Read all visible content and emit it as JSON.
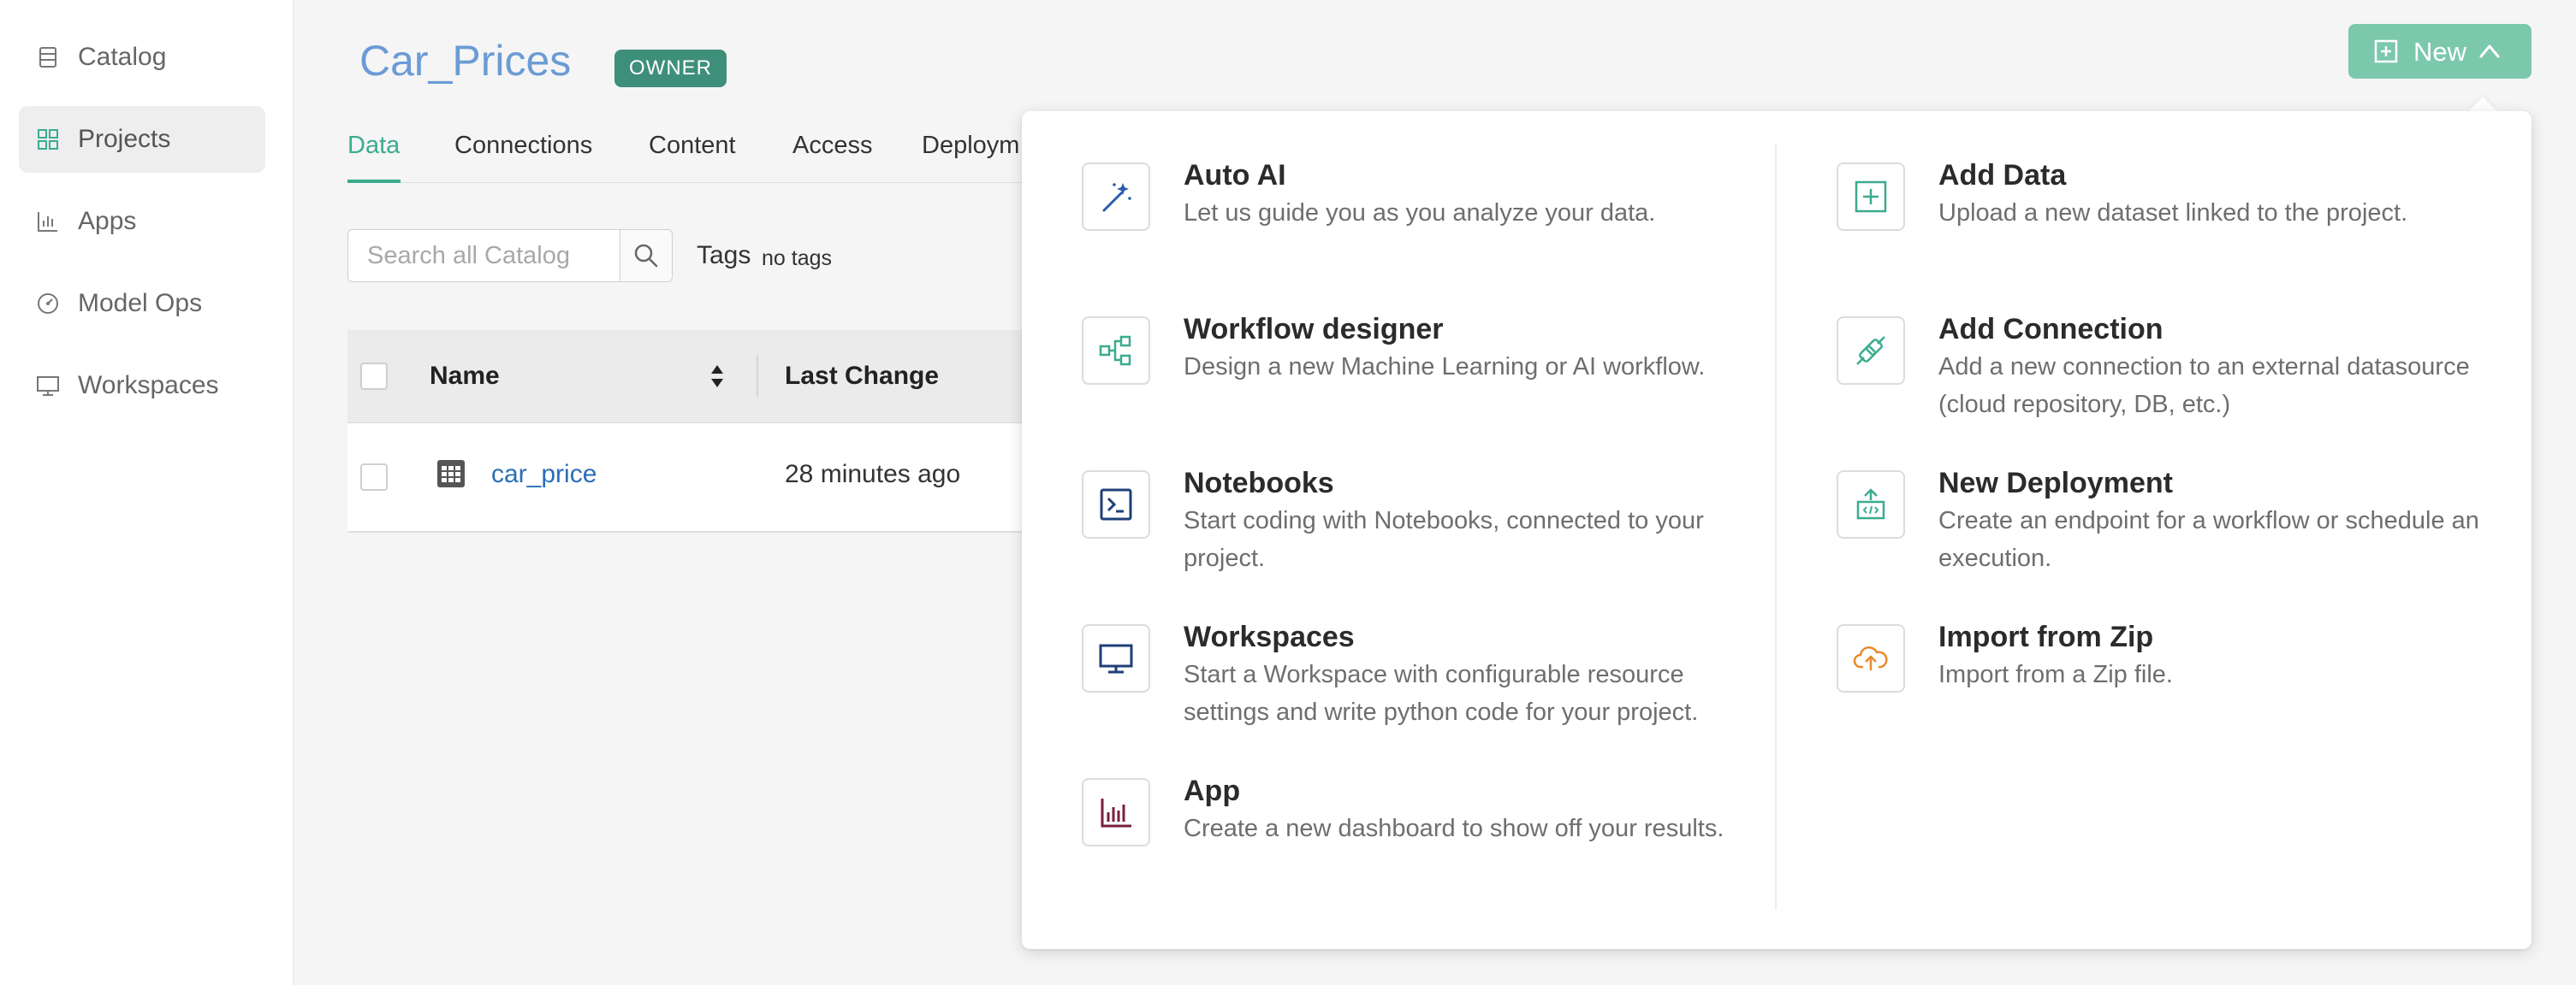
{
  "sidebar": {
    "items": [
      {
        "label": "Catalog",
        "icon": "catalog-icon",
        "active": false
      },
      {
        "label": "Projects",
        "icon": "projects-icon",
        "active": true
      },
      {
        "label": "Apps",
        "icon": "apps-icon",
        "active": false
      },
      {
        "label": "Model Ops",
        "icon": "model-ops-icon",
        "active": false
      },
      {
        "label": "Workspaces",
        "icon": "workspaces-icon",
        "active": false
      }
    ]
  },
  "header": {
    "title": "Car_Prices",
    "badge": "OWNER",
    "new_button": "New"
  },
  "tabs": [
    "Data",
    "Connections",
    "Content",
    "Access",
    "Deploym"
  ],
  "active_tab": "Data",
  "search": {
    "placeholder": "Search all Catalog"
  },
  "tags": {
    "label": "Tags",
    "value": "no tags"
  },
  "table": {
    "columns": [
      "Name",
      "Last Change"
    ],
    "rows": [
      {
        "name": "car_price",
        "last_change": "28 minutes ago"
      }
    ]
  },
  "menu": {
    "left": [
      {
        "title": "Auto AI",
        "desc": "Let us guide you as you analyze your data.",
        "icon": "magic-wand-icon"
      },
      {
        "title": "Workflow designer",
        "desc": "Design a new Machine Learning or AI workflow.",
        "icon": "workflow-icon"
      },
      {
        "title": "Notebooks",
        "desc": "Start coding with Notebooks, connected to your project.",
        "icon": "terminal-icon"
      },
      {
        "title": "Workspaces",
        "desc": "Start a Workspace with configurable resource settings and write python code for your project.",
        "icon": "monitor-icon"
      },
      {
        "title": "App",
        "desc": "Create a new dashboard to show off your results.",
        "icon": "bar-chart-icon"
      }
    ],
    "right": [
      {
        "title": "Add Data",
        "desc": "Upload a new dataset linked to the project.",
        "icon": "add-square-icon"
      },
      {
        "title": "Add Connection",
        "desc": "Add a new connection to an external datasource (cloud repository, DB, etc.)",
        "icon": "plug-icon"
      },
      {
        "title": "New Deployment",
        "desc": "Create an endpoint for a workflow or schedule an execution.",
        "icon": "deploy-icon"
      },
      {
        "title": "Import from Zip",
        "desc": "Import from a Zip file.",
        "icon": "cloud-upload-icon"
      }
    ]
  },
  "colors": {
    "accent": "#3bab8e",
    "new_button": "#7cc8ad",
    "title": "#6b9bd6",
    "badge": "#3e8f7a"
  }
}
